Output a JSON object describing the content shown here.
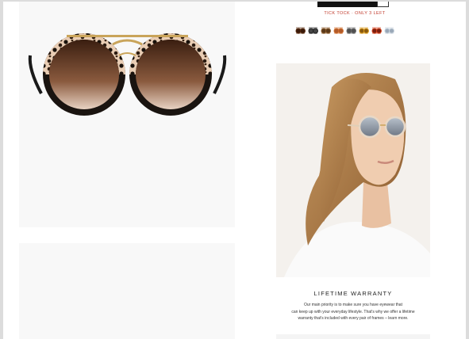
{
  "product": {
    "stock_notice": "TICK TOCK · ONLY 3 LEFT",
    "quantity_indicator": "+",
    "swatches": [
      {
        "name": "dark-tortoise",
        "frame": "#5a2e12",
        "lens": "#3a1a0a"
      },
      {
        "name": "black-crystal",
        "frame": "#222222",
        "lens": "#444444"
      },
      {
        "name": "tortoise-gold",
        "frame": "#8a5a2a",
        "lens": "#5a3a1a"
      },
      {
        "name": "orange-amber",
        "frame": "#d07030",
        "lens": "#b05a2a"
      },
      {
        "name": "smoke-grey",
        "frame": "#6a6a6a",
        "lens": "#505050"
      },
      {
        "name": "honey-yellow",
        "frame": "#d99a1c",
        "lens": "#8a5a10"
      },
      {
        "name": "red-crystal",
        "frame": "#d0401c",
        "lens": "#7a2010"
      },
      {
        "name": "clear-blue",
        "frame": "#c8d2dc",
        "lens": "#9aa8b8"
      }
    ]
  },
  "warranty": {
    "title": "LIFETIME WARRANTY",
    "line1": "Our main priority is to make sure you have eyewear that",
    "line2": "can keep up with your everyday lifestyle. That's why we offer a lifetime",
    "line3": "warranty that's included with every pair of frames – learn more."
  }
}
